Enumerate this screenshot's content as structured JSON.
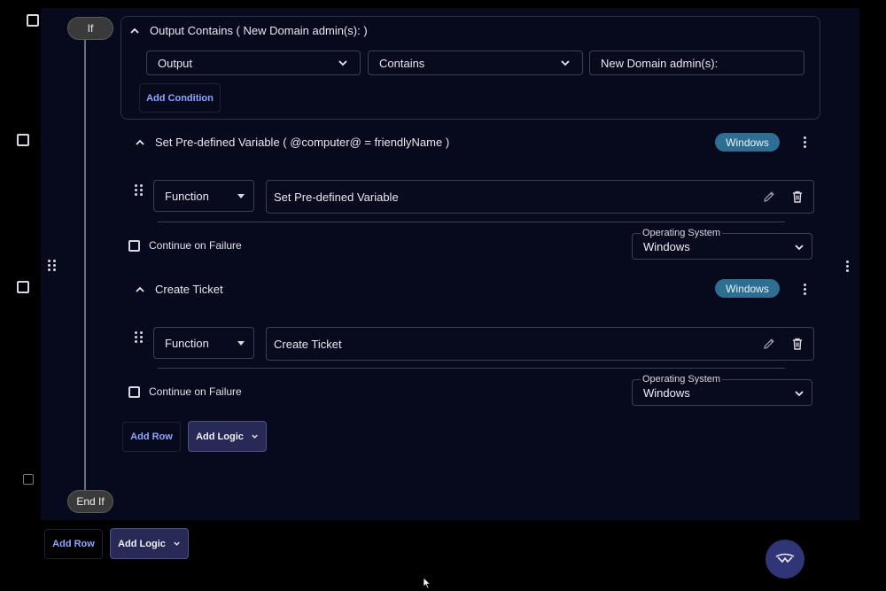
{
  "if_block": {
    "if_label": "If",
    "end_if_label": "End If"
  },
  "condition": {
    "title": "Output Contains ( New Domain admin(s): )",
    "field_select": "Output",
    "operator_select": "Contains",
    "value": "New Domain admin(s):",
    "add_condition_label": "Add Condition"
  },
  "steps": [
    {
      "title": "Set Pre-defined Variable ( @computer@ = friendlyName )",
      "badge": "Windows",
      "type_select": "Function",
      "function_name": "Set Pre-defined Variable",
      "continue_on_failure_label": "Continue on Failure",
      "os_label": "Operating System",
      "os_value": "Windows"
    },
    {
      "title": "Create Ticket",
      "badge": "Windows",
      "type_select": "Function",
      "function_name": "Create Ticket",
      "continue_on_failure_label": "Continue on Failure",
      "os_label": "Operating System",
      "os_value": "Windows"
    }
  ],
  "inner_actions": {
    "add_row_label": "Add Row",
    "add_logic_label": "Add Logic"
  },
  "outer_actions": {
    "add_row_label": "Add Row",
    "add_logic_label": "Add Logic"
  },
  "icons": {
    "collapse": "chevron-up-icon",
    "dropdown": "chevron-down-icon",
    "edit": "pencil-icon",
    "delete": "trash-icon",
    "more": "kebab-menu-icon",
    "drag": "drag-handle-icon",
    "fab": "logo-icon"
  },
  "colors": {
    "badge": "#2f6e93",
    "accent_link": "#8fa5ff",
    "primary_button": "#262a55",
    "panel": "#070a1c"
  }
}
